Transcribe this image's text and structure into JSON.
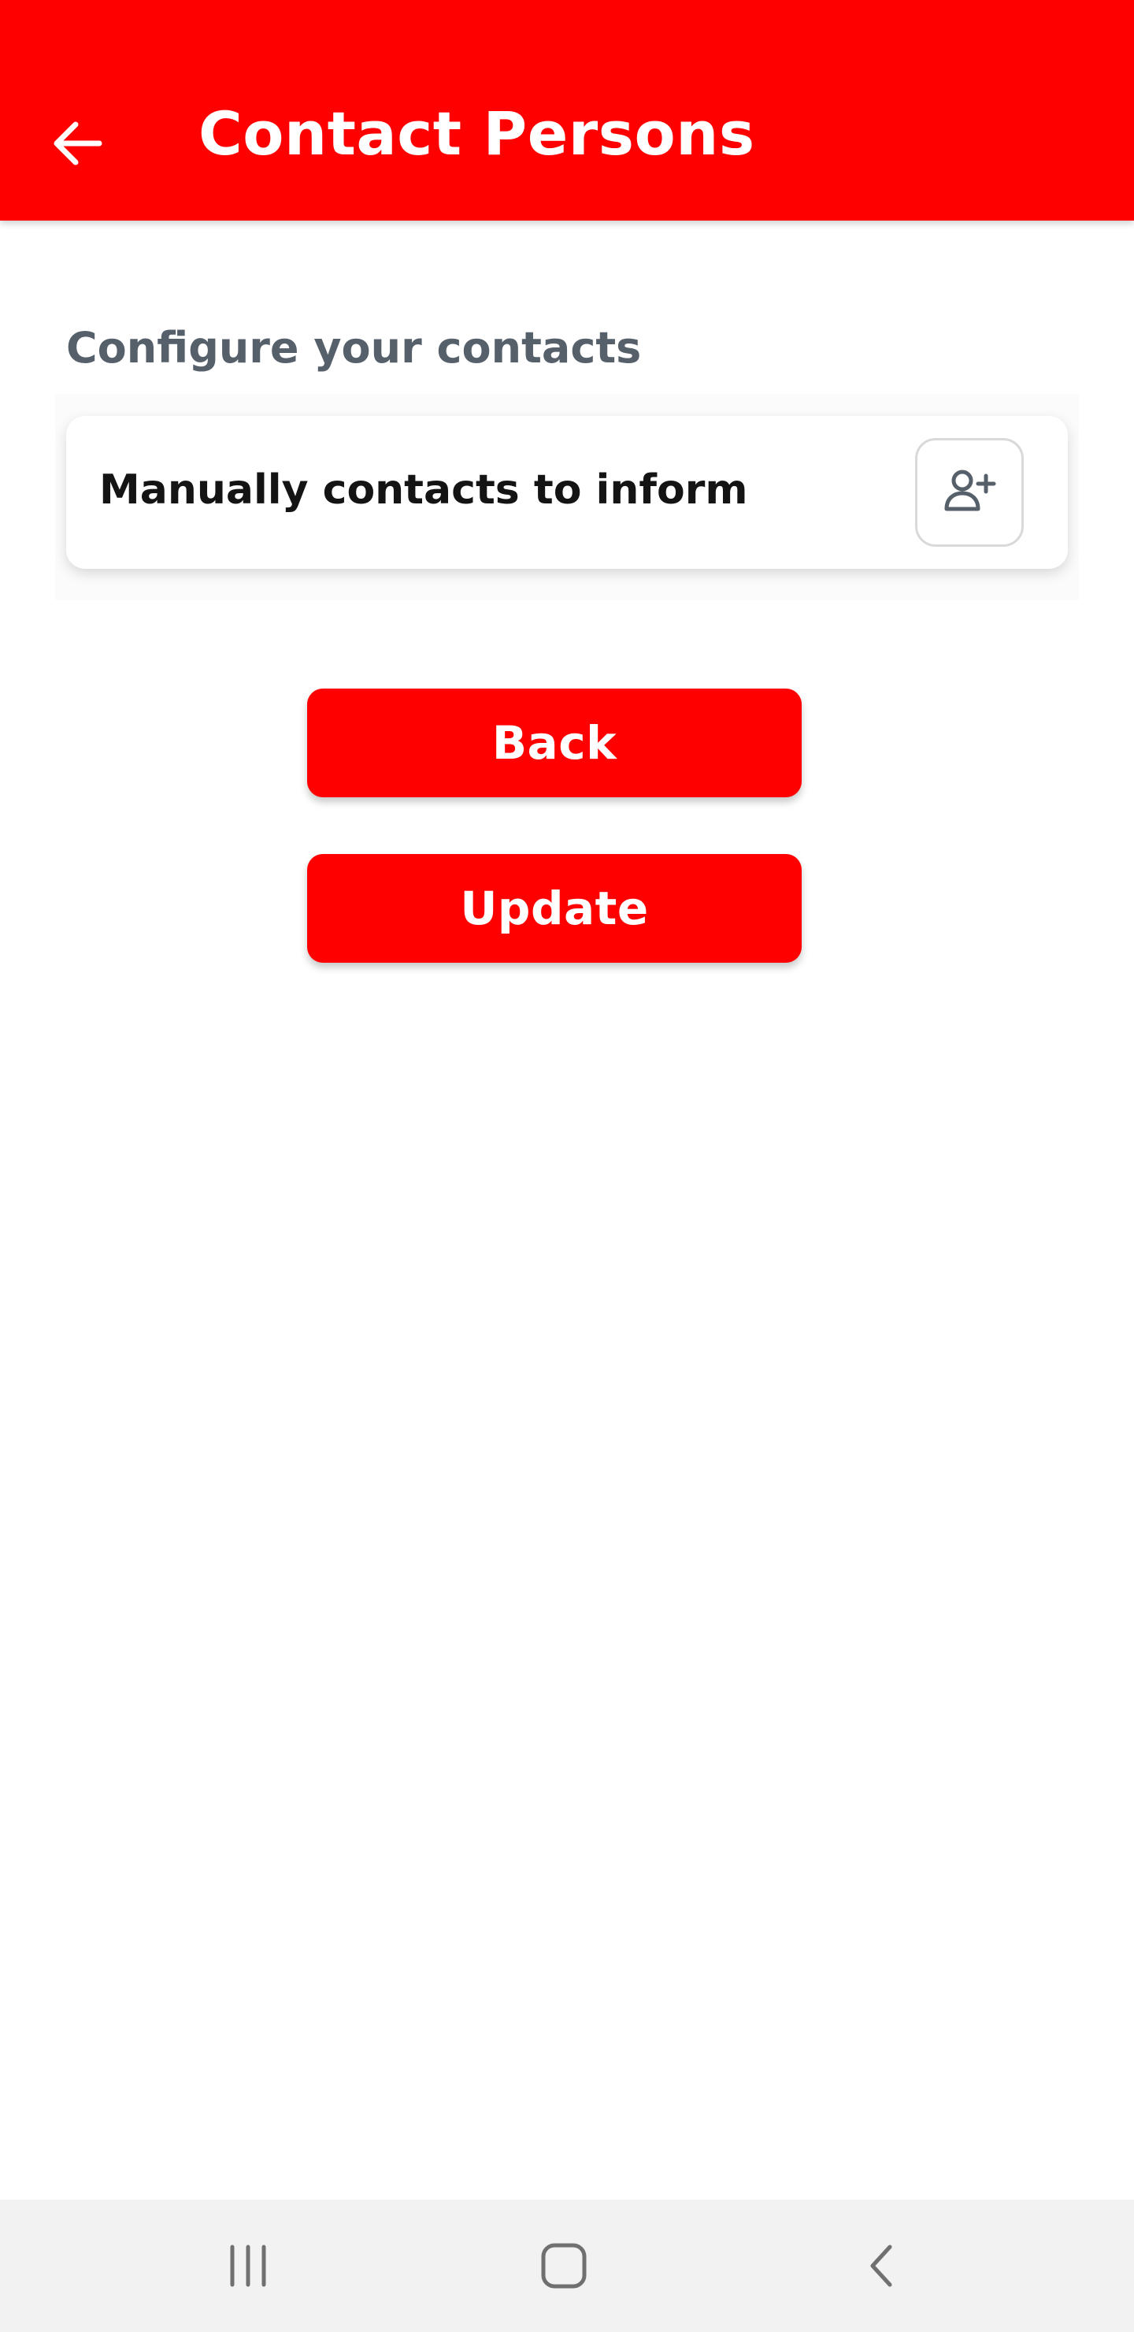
{
  "header": {
    "title": "Contact Persons",
    "back_icon": "arrow-left-icon",
    "background_color": "#ff0000"
  },
  "section": {
    "label": "Configure your contacts"
  },
  "contact_card": {
    "label": "Manually contacts to inform",
    "action_icon": "person-add-icon"
  },
  "buttons": {
    "back_label": "Back",
    "update_label": "Update",
    "color": "#ff0000"
  },
  "system_nav": {
    "recents_icon": "recents-icon",
    "home_icon": "home-icon",
    "back_icon": "nav-back-icon"
  }
}
